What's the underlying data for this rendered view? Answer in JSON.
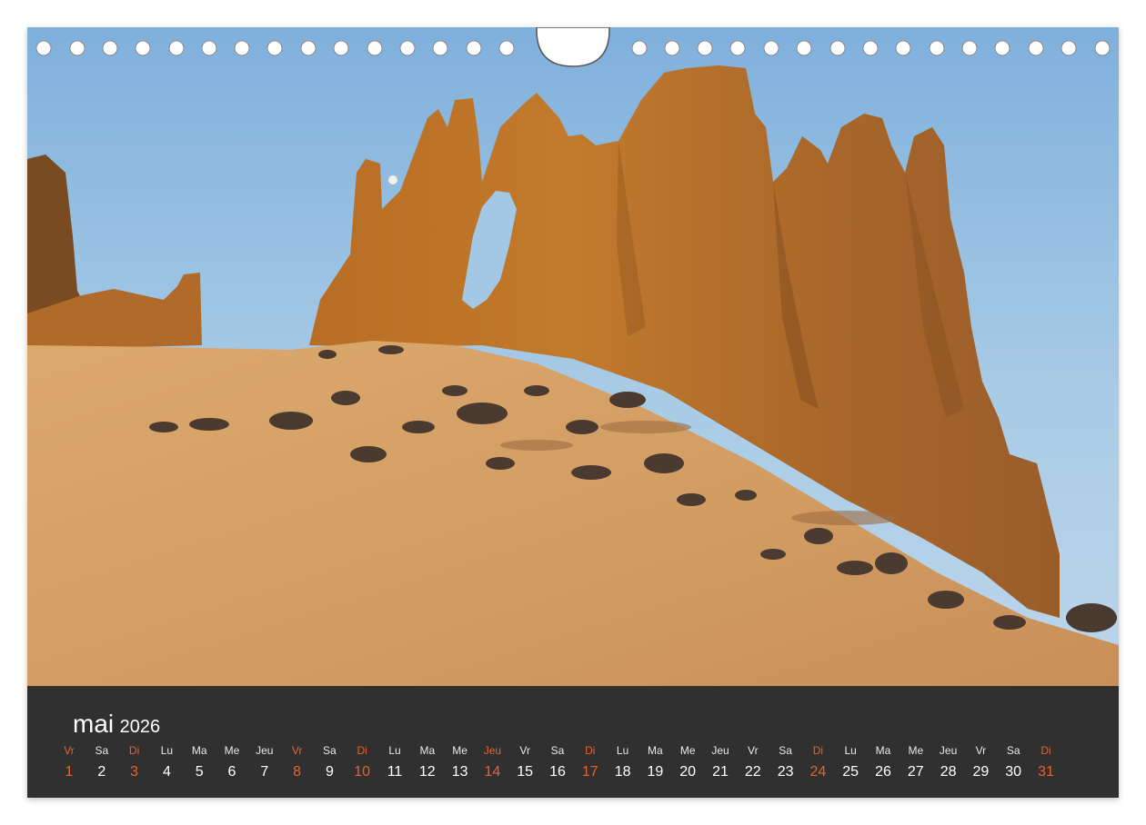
{
  "calendar": {
    "month": "mai",
    "year": "2026",
    "accent_color": "#e8622a",
    "days": [
      {
        "dow": "Vr",
        "num": "1",
        "hl": true
      },
      {
        "dow": "Sa",
        "num": "2",
        "hl": false
      },
      {
        "dow": "Di",
        "num": "3",
        "hl": true
      },
      {
        "dow": "Lu",
        "num": "4",
        "hl": false
      },
      {
        "dow": "Ma",
        "num": "5",
        "hl": false
      },
      {
        "dow": "Me",
        "num": "6",
        "hl": false
      },
      {
        "dow": "Jeu",
        "num": "7",
        "hl": false
      },
      {
        "dow": "Vr",
        "num": "8",
        "hl": true
      },
      {
        "dow": "Sa",
        "num": "9",
        "hl": false
      },
      {
        "dow": "Di",
        "num": "10",
        "hl": true
      },
      {
        "dow": "Lu",
        "num": "11",
        "hl": false
      },
      {
        "dow": "Ma",
        "num": "12",
        "hl": false
      },
      {
        "dow": "Me",
        "num": "13",
        "hl": false
      },
      {
        "dow": "Jeu",
        "num": "14",
        "hl": true
      },
      {
        "dow": "Vr",
        "num": "15",
        "hl": false
      },
      {
        "dow": "Sa",
        "num": "16",
        "hl": false
      },
      {
        "dow": "Di",
        "num": "17",
        "hl": true
      },
      {
        "dow": "Lu",
        "num": "18",
        "hl": false
      },
      {
        "dow": "Ma",
        "num": "19",
        "hl": false
      },
      {
        "dow": "Me",
        "num": "20",
        "hl": false
      },
      {
        "dow": "Jeu",
        "num": "21",
        "hl": false
      },
      {
        "dow": "Vr",
        "num": "22",
        "hl": false
      },
      {
        "dow": "Sa",
        "num": "23",
        "hl": false
      },
      {
        "dow": "Di",
        "num": "24",
        "hl": true
      },
      {
        "dow": "Lu",
        "num": "25",
        "hl": false
      },
      {
        "dow": "Ma",
        "num": "26",
        "hl": false
      },
      {
        "dow": "Me",
        "num": "27",
        "hl": false
      },
      {
        "dow": "Jeu",
        "num": "28",
        "hl": false
      },
      {
        "dow": "Vr",
        "num": "29",
        "hl": false
      },
      {
        "dow": "Sa",
        "num": "30",
        "hl": false
      },
      {
        "dow": "Di",
        "num": "31",
        "hl": true
      }
    ]
  }
}
